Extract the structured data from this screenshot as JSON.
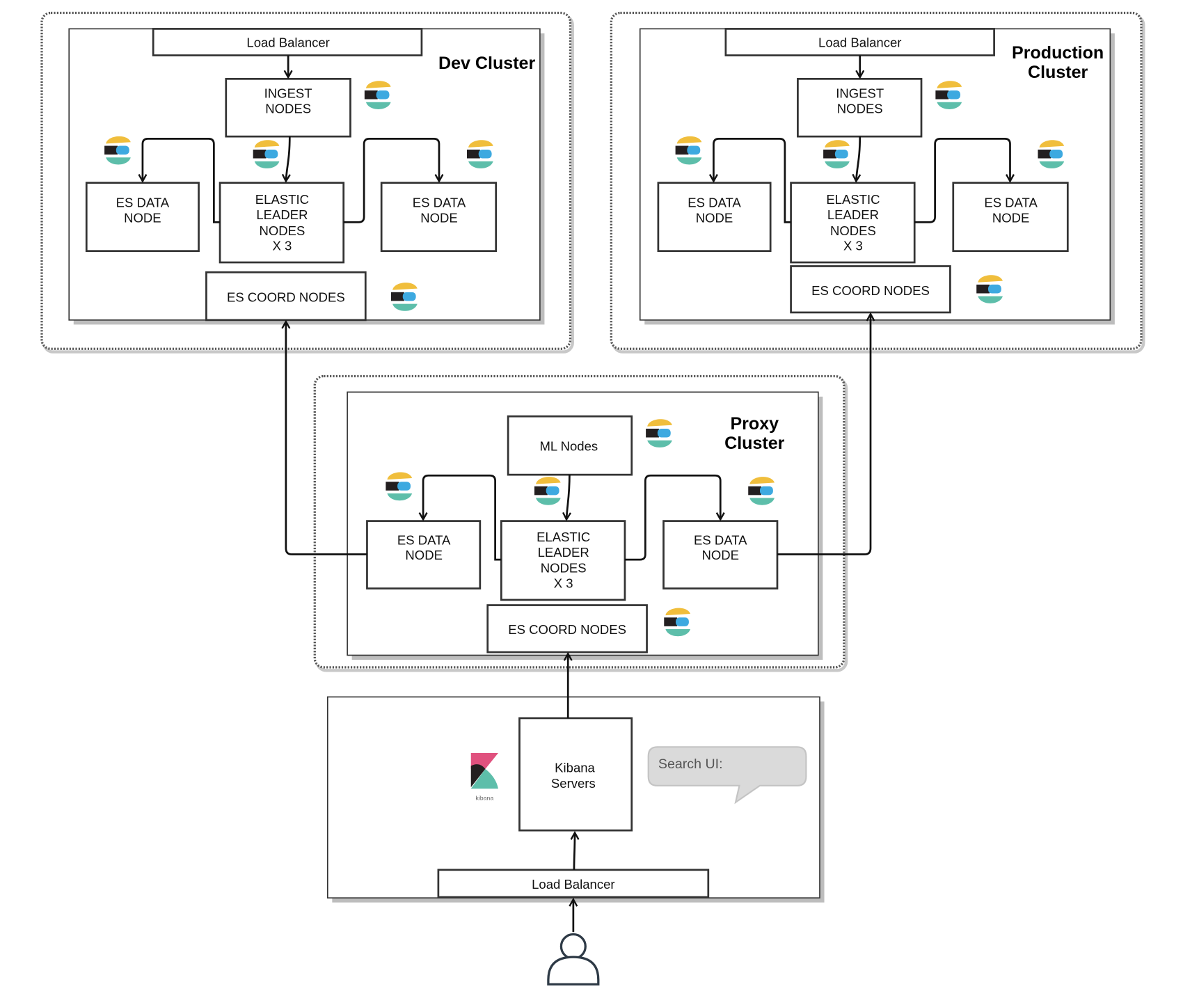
{
  "dev_cluster": {
    "title": "Dev Cluster",
    "load_balancer": "Load Balancer",
    "ingest": [
      "INGEST",
      "NODES"
    ],
    "data_left": [
      "ES DATA",
      "NODE"
    ],
    "leader": [
      "ELASTIC",
      "LEADER",
      "NODES",
      "X 3"
    ],
    "data_right": [
      "ES DATA",
      "NODE"
    ],
    "coord": "ES COORD NODES"
  },
  "production_cluster": {
    "title": [
      "Production",
      "Cluster"
    ],
    "load_balancer": "Load Balancer",
    "ingest": [
      "INGEST",
      "NODES"
    ],
    "data_left": [
      "ES DATA",
      "NODE"
    ],
    "leader": [
      "ELASTIC",
      "LEADER",
      "NODES",
      "X 3"
    ],
    "data_right": [
      "ES DATA",
      "NODE"
    ],
    "coord": "ES COORD NODES"
  },
  "proxy_cluster": {
    "title": [
      "Proxy",
      "Cluster"
    ],
    "ml": "ML Nodes",
    "data_left": [
      "ES DATA",
      "NODE"
    ],
    "leader": [
      "ELASTIC",
      "LEADER",
      "NODES",
      "X 3"
    ],
    "data_right": [
      "ES DATA",
      "NODE"
    ],
    "coord": "ES COORD NODES"
  },
  "frontend": {
    "kibana": [
      "Kibana",
      "Servers"
    ],
    "kibana_logo_text": "kibana",
    "search_bubble": "Search UI:",
    "load_balancer": "Load Balancer"
  },
  "icons": {
    "elastic": "elasticsearch-logo-icon",
    "kibana": "kibana-logo-icon",
    "user": "user-icon"
  },
  "colors": {
    "elastic_yellow": "#F0BE3C",
    "elastic_blue": "#3DA9E0",
    "elastic_teal": "#5DBEAA",
    "elastic_black": "#231F20",
    "kibana_pink": "#E0517E",
    "bubble_fill": "#DADADA"
  }
}
